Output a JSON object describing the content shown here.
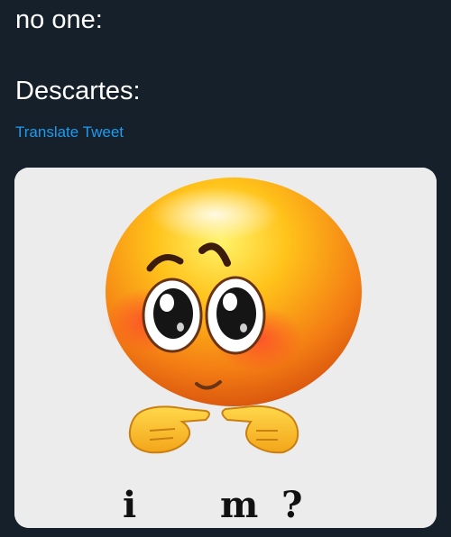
{
  "tweet": {
    "lines": [
      "no one:",
      "Descartes:"
    ],
    "translate_label": "Translate Tweet"
  },
  "media": {
    "type": "image",
    "description_icon": "blushing-emoji-pointing-fingers",
    "caption_letters": [
      "i",
      "m",
      "?"
    ]
  },
  "colors": {
    "background": "#15202b",
    "text": "#ffffff",
    "link": "#1d9bf0",
    "media_background": "#ececec"
  }
}
